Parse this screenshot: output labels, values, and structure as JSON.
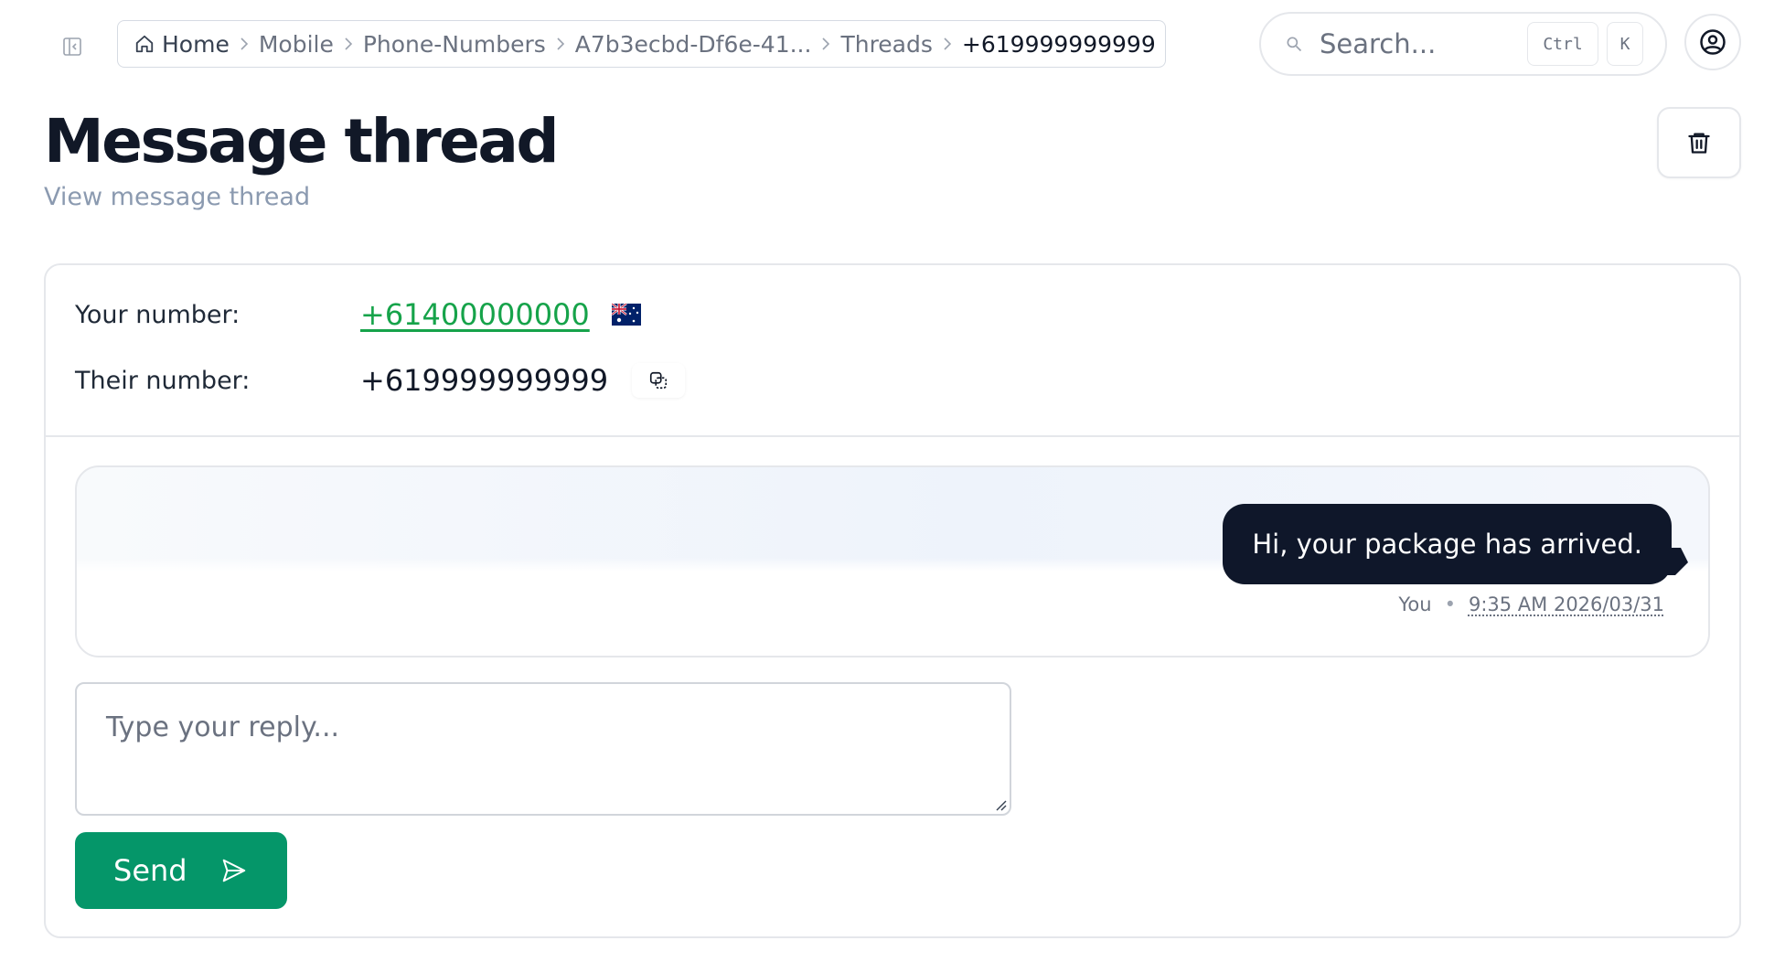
{
  "breadcrumb": {
    "items": [
      {
        "label": "Home",
        "icon": "home-icon"
      },
      {
        "label": "Mobile"
      },
      {
        "label": "Phone-Numbers"
      },
      {
        "label": "A7b3ecbd-Df6e-41..."
      },
      {
        "label": "Threads"
      },
      {
        "label": "+619999999999"
      }
    ]
  },
  "search": {
    "placeholder": "Search...",
    "shortcut_modifier": "Ctrl",
    "shortcut_key": "K"
  },
  "header": {
    "title": "Message thread",
    "subtitle": "View message thread"
  },
  "numbers": {
    "your_label": "Your number:",
    "your_value": "+61400000000",
    "your_flag": "australia-flag",
    "their_label": "Their number:",
    "their_value": "+619999999999"
  },
  "messages": [
    {
      "text": "Hi, your package has arrived.",
      "sender": "You",
      "time": "9:35 AM 2026/03/31"
    }
  ],
  "reply": {
    "placeholder": "Type your reply...",
    "send_label": "Send"
  },
  "colors": {
    "accent_green": "#059669",
    "link_green": "#16a34a",
    "bubble_dark": "#0f172a"
  }
}
